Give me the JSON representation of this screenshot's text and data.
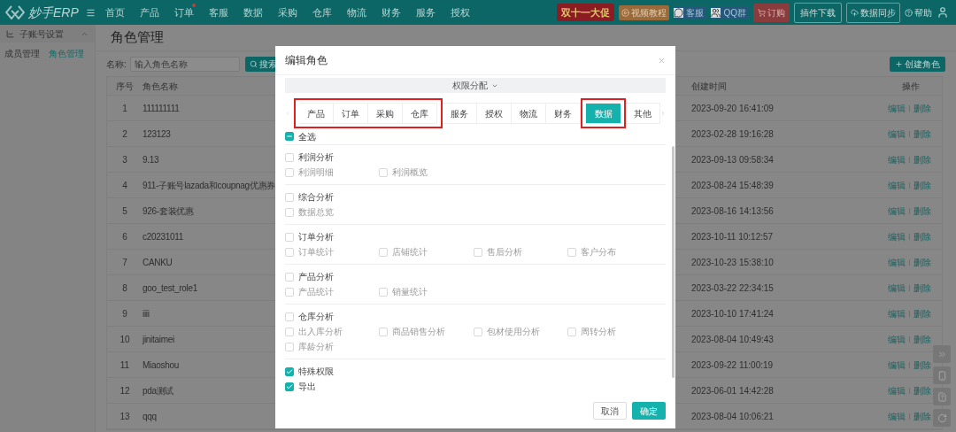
{
  "nav": {
    "logo": "妙手ERP",
    "items": [
      {
        "label": "首页",
        "dot": false
      },
      {
        "label": "产品",
        "dot": false
      },
      {
        "label": "订单",
        "dot": true
      },
      {
        "label": "客服",
        "dot": false
      },
      {
        "label": "数据",
        "dot": false
      },
      {
        "label": "采购",
        "dot": false
      },
      {
        "label": "仓库",
        "dot": false
      },
      {
        "label": "物流",
        "dot": false
      },
      {
        "label": "财务",
        "dot": false
      },
      {
        "label": "服务",
        "dot": false
      },
      {
        "label": "授权",
        "dot": false
      }
    ],
    "promo": "双十一大促",
    "video": "视频教程",
    "service": "客服",
    "qq": "QQ群",
    "order": "订购",
    "plugin": "插件下载",
    "sync": "数据同步",
    "help": "帮助"
  },
  "sidebar": {
    "section": "子账号设置",
    "expanded": true,
    "items": [
      {
        "label": "成员管理",
        "selected": false
      },
      {
        "label": "角色管理",
        "selected": true
      }
    ]
  },
  "page": {
    "title": "角色管理",
    "search_label": "名称:",
    "search": {
      "placeholder": "输入角色名称"
    },
    "search_button": "搜索",
    "create_button": "创建角色",
    "table": {
      "columns": [
        "序号",
        "角色名称",
        "创建时间",
        "操作"
      ],
      "rows": [
        {
          "no": "1",
          "name": "111111111",
          "created": "2023-09-20 16:41:09",
          "actions": [
            "编辑",
            "删除"
          ]
        },
        {
          "no": "2",
          "name": "123123",
          "created": "2023-02-28 19:16:28",
          "actions": [
            "编辑",
            "删除"
          ]
        },
        {
          "no": "3",
          "name": "9.13",
          "created": "2023-09-13 09:58:34",
          "actions": [
            "编辑",
            "删除"
          ]
        },
        {
          "no": "4",
          "name": "911-子账号lazada和coupnag优惠券",
          "created": "2023-08-24 15:48:39",
          "actions": [
            "编辑",
            "删除"
          ]
        },
        {
          "no": "5",
          "name": "926-套装优惠",
          "created": "2023-08-16 14:13:56",
          "actions": [
            "编辑",
            "删除"
          ]
        },
        {
          "no": "6",
          "name": "c20231011",
          "created": "2023-10-11 10:12:57",
          "actions": [
            "编辑",
            "删除"
          ]
        },
        {
          "no": "7",
          "name": "CANKU",
          "created": "2023-10-23 15:38:10",
          "actions": [
            "编辑",
            "删除"
          ]
        },
        {
          "no": "8",
          "name": "goo_test_role1",
          "created": "2023-03-22 22:34:15",
          "actions": [
            "编辑",
            "删除"
          ]
        },
        {
          "no": "9",
          "name": "iiii",
          "created": "2023-10-10 17:41:24",
          "actions": [
            "编辑",
            "删除"
          ]
        },
        {
          "no": "10",
          "name": "jinitaimei",
          "created": "2023-08-04 10:49:43",
          "actions": [
            "编辑",
            "删除"
          ]
        },
        {
          "no": "11",
          "name": "Miaoshou",
          "created": "2023-09-22 11:00:19",
          "actions": [
            "编辑",
            "删除"
          ]
        },
        {
          "no": "12",
          "name": "pda测试",
          "created": "2023-06-01 14:42:28",
          "actions": [
            "编辑",
            "删除"
          ]
        },
        {
          "no": "13",
          "name": "qqq",
          "created": "2023-08-04 10:06:21",
          "actions": [
            "编辑",
            "删除"
          ]
        }
      ]
    }
  },
  "modal": {
    "title": "编辑角色",
    "section": "权限分配",
    "tabs": [
      {
        "label": "产品",
        "selected": false,
        "highlighted": true
      },
      {
        "label": "订单",
        "selected": false,
        "highlighted": true
      },
      {
        "label": "采购",
        "selected": false,
        "highlighted": true
      },
      {
        "label": "仓库",
        "selected": false,
        "highlighted": true
      },
      {
        "label": "服务",
        "selected": false,
        "highlighted": false
      },
      {
        "label": "授权",
        "selected": false,
        "highlighted": false
      },
      {
        "label": "物流",
        "selected": false,
        "highlighted": false
      },
      {
        "label": "财务",
        "selected": false,
        "highlighted": false
      },
      {
        "label": "数据",
        "selected": true,
        "highlighted": true
      },
      {
        "label": "其他",
        "selected": false,
        "highlighted": false
      }
    ],
    "select_all": {
      "label": "全选",
      "indeterminate": true
    },
    "groups": [
      {
        "label": "利润分析",
        "checked": false,
        "options": [
          {
            "label": "利润明细",
            "checked": false
          },
          {
            "label": "利润概览",
            "checked": false
          }
        ]
      },
      {
        "label": "综合分析",
        "checked": false,
        "options": [
          {
            "label": "数据总览",
            "checked": false
          }
        ]
      },
      {
        "label": "订单分析",
        "checked": false,
        "options": [
          {
            "label": "订单统计",
            "checked": false
          },
          {
            "label": "店铺统计",
            "checked": false
          },
          {
            "label": "售后分析",
            "checked": false
          },
          {
            "label": "客户分布",
            "checked": false
          }
        ]
      },
      {
        "label": "产品分析",
        "checked": false,
        "options": [
          {
            "label": "产品统计",
            "checked": false
          },
          {
            "label": "销量统计",
            "checked": false
          }
        ]
      },
      {
        "label": "仓库分析",
        "checked": false,
        "options": [
          {
            "label": "出入库分析",
            "checked": false
          },
          {
            "label": "商品销售分析",
            "checked": false
          },
          {
            "label": "包材使用分析",
            "checked": false
          },
          {
            "label": "周转分析",
            "checked": false
          },
          {
            "label": "库龄分析",
            "checked": false
          }
        ]
      }
    ],
    "extras": [
      {
        "label": "特殊权限",
        "checked": true
      },
      {
        "label": "导出",
        "checked": true
      }
    ],
    "cancel": "取消",
    "ok": "确定"
  }
}
